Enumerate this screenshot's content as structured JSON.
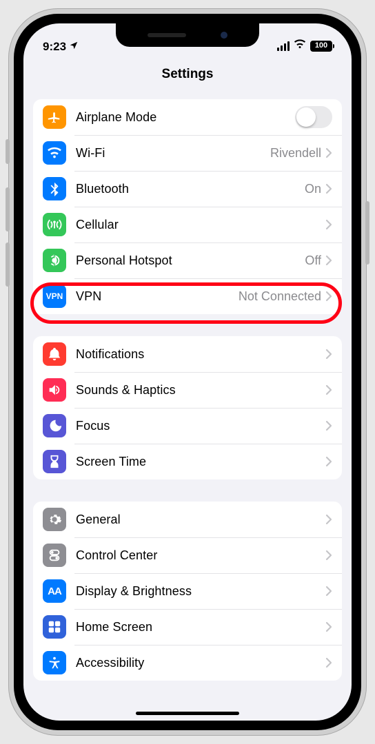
{
  "status": {
    "time": "9:23",
    "battery": "100"
  },
  "header": {
    "title": "Settings"
  },
  "groups": [
    {
      "rows": [
        {
          "icon": "airplane",
          "bg": "#ff9500",
          "label": "Airplane Mode",
          "control": "toggle"
        },
        {
          "icon": "wifi",
          "bg": "#007aff",
          "label": "Wi-Fi",
          "value": "Rivendell",
          "control": "disclosure"
        },
        {
          "icon": "bluetooth",
          "bg": "#007aff",
          "label": "Bluetooth",
          "value": "On",
          "control": "disclosure"
        },
        {
          "icon": "cellular",
          "bg": "#34c759",
          "label": "Cellular",
          "control": "disclosure",
          "highlight": true
        },
        {
          "icon": "hotspot",
          "bg": "#34c759",
          "label": "Personal Hotspot",
          "value": "Off",
          "control": "disclosure"
        },
        {
          "icon": "vpn",
          "bg": "#007aff",
          "label": "VPN",
          "value": "Not Connected",
          "control": "disclosure"
        }
      ]
    },
    {
      "rows": [
        {
          "icon": "notifications",
          "bg": "#ff3b30",
          "label": "Notifications",
          "control": "disclosure"
        },
        {
          "icon": "sounds",
          "bg": "#ff2d55",
          "label": "Sounds & Haptics",
          "control": "disclosure"
        },
        {
          "icon": "focus",
          "bg": "#5856d6",
          "label": "Focus",
          "control": "disclosure"
        },
        {
          "icon": "screentime",
          "bg": "#5856d6",
          "label": "Screen Time",
          "control": "disclosure"
        }
      ]
    },
    {
      "rows": [
        {
          "icon": "general",
          "bg": "#8e8e93",
          "label": "General",
          "control": "disclosure"
        },
        {
          "icon": "control",
          "bg": "#8e8e93",
          "label": "Control Center",
          "control": "disclosure"
        },
        {
          "icon": "display",
          "bg": "#007aff",
          "label": "Display & Brightness",
          "control": "disclosure"
        },
        {
          "icon": "homescreen",
          "bg": "#3062da",
          "label": "Home Screen",
          "control": "disclosure"
        },
        {
          "icon": "accessibility",
          "bg": "#007aff",
          "label": "Accessibility",
          "control": "disclosure"
        }
      ]
    }
  ]
}
